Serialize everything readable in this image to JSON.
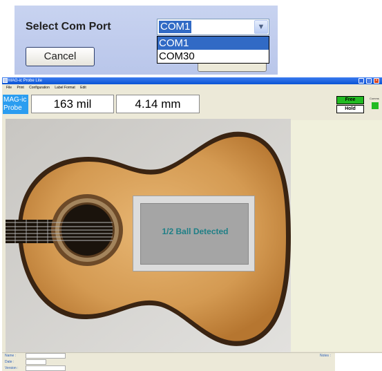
{
  "dialog": {
    "label": "Select Com Port",
    "combo_value": "COM1",
    "options": [
      "COM1",
      "COM30"
    ],
    "cancel_label": "Cancel"
  },
  "app": {
    "title": "MAG-ic Probe Lite",
    "menu": [
      "File",
      "Print",
      "Configuration",
      "Label Format",
      "Edit"
    ],
    "logo_line1": "MAG-ic",
    "logo_line2": "Probe",
    "reading_mil": "163 mil",
    "reading_mm": "4.14 mm",
    "free_label": "Free",
    "hold_label": "Hold",
    "comms_label": "Comms",
    "overlay_message": "1/2 Ball Detected",
    "footer": {
      "name_label": "Name :",
      "date_label": "Date :",
      "version_label": "Version :",
      "notes_label": "Notes :"
    }
  },
  "colors": {
    "title_blue": "#0a54d4",
    "free_green": "#22bb22",
    "overlay_text": "#1f7f86",
    "logo_blue": "#2b9df0"
  }
}
